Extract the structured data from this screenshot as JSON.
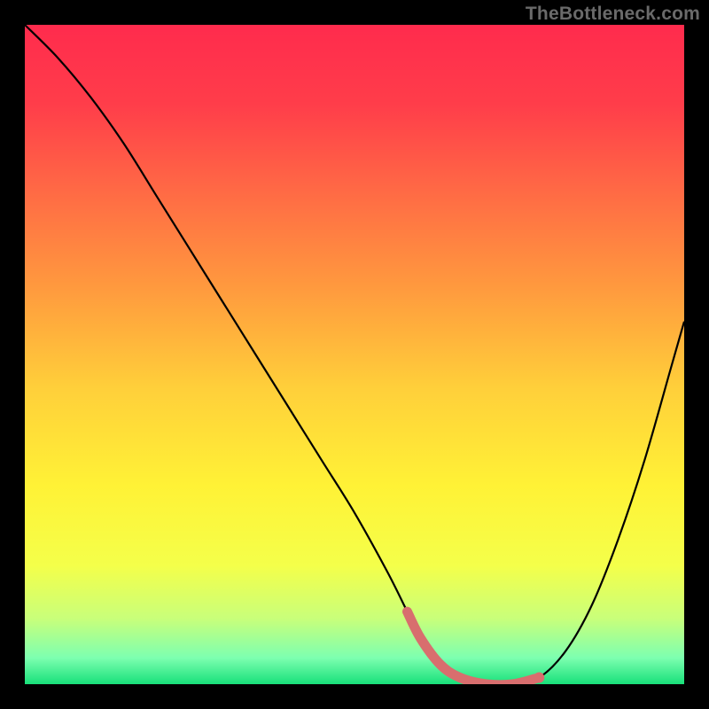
{
  "watermark": "TheBottleneck.com",
  "chart_data": {
    "type": "line",
    "title": "",
    "xlabel": "",
    "ylabel": "",
    "xlim": [
      0,
      100
    ],
    "ylim": [
      0,
      100
    ],
    "grid": false,
    "legend": false,
    "background": {
      "type": "vertical-gradient",
      "stops": [
        {
          "pos": 0.0,
          "color": "#ff2b4d"
        },
        {
          "pos": 0.12,
          "color": "#ff3d4a"
        },
        {
          "pos": 0.25,
          "color": "#ff6945"
        },
        {
          "pos": 0.4,
          "color": "#ff9a3e"
        },
        {
          "pos": 0.55,
          "color": "#ffcf3a"
        },
        {
          "pos": 0.7,
          "color": "#fff236"
        },
        {
          "pos": 0.82,
          "color": "#f4ff4a"
        },
        {
          "pos": 0.9,
          "color": "#c9ff7a"
        },
        {
          "pos": 0.96,
          "color": "#7dffb0"
        },
        {
          "pos": 1.0,
          "color": "#18e07a"
        }
      ]
    },
    "series": [
      {
        "name": "bottleneck-curve",
        "color": "#000000",
        "x": [
          0,
          5,
          10,
          15,
          20,
          25,
          30,
          35,
          40,
          45,
          50,
          55,
          58,
          60,
          63,
          66,
          70,
          74,
          78,
          82,
          86,
          90,
          94,
          98,
          100
        ],
        "y": [
          100,
          95,
          89,
          82,
          74,
          66,
          58,
          50,
          42,
          34,
          26,
          17,
          11,
          7,
          3,
          1,
          0,
          0,
          1,
          5,
          12,
          22,
          34,
          48,
          55
        ]
      }
    ],
    "highlight": {
      "name": "optimal-range",
      "color": "#d86e6e",
      "x": [
        58,
        60,
        63,
        66,
        70,
        74,
        78
      ],
      "y": [
        11,
        7,
        3,
        1,
        0,
        0,
        1
      ]
    }
  }
}
